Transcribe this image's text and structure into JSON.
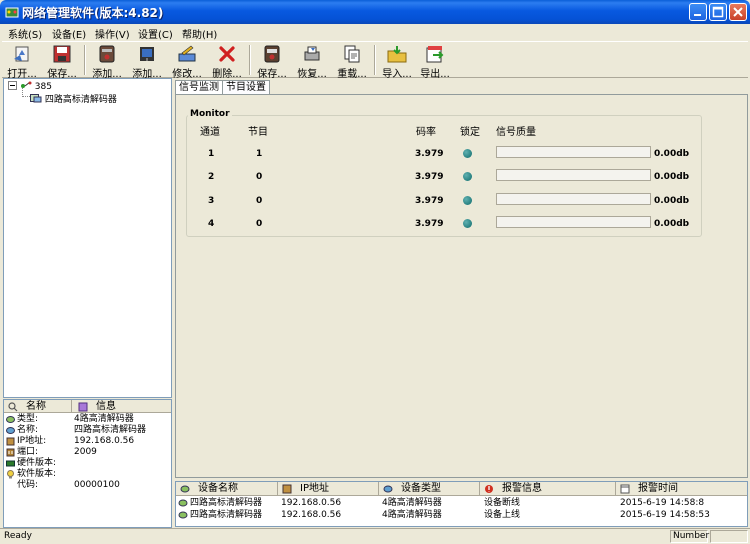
{
  "window": {
    "title": "网络管理软件(版本:4.82)"
  },
  "menu": [
    {
      "label": "系统(S)"
    },
    {
      "label": "设备(E)"
    },
    {
      "label": "操作(V)"
    },
    {
      "label": "设置(C)"
    },
    {
      "label": "帮助(H)"
    }
  ],
  "toolbar": [
    {
      "label": "打开...",
      "icon": "open-icon"
    },
    {
      "label": "保存...",
      "icon": "save-disk-icon"
    },
    {
      "label": "添加...",
      "icon": "add-device-icon"
    },
    {
      "label": "添加...",
      "icon": "add-device-2-icon"
    },
    {
      "label": "修改...",
      "icon": "edit-icon"
    },
    {
      "label": "删除...",
      "icon": "delete-x-icon"
    },
    {
      "label": "保存...",
      "icon": "save-device-icon"
    },
    {
      "label": "恢复...",
      "icon": "restore-icon"
    },
    {
      "label": "重载...",
      "icon": "reload-icon"
    },
    {
      "label": "导入...",
      "icon": "import-icon"
    },
    {
      "label": "导出...",
      "icon": "export-icon"
    }
  ],
  "tree": {
    "root": "385",
    "child": "四路高标清解码器"
  },
  "properties": {
    "col_name": "名称",
    "col_info": "信息",
    "rows": [
      {
        "key": "类型:",
        "value": "4路高清解码器"
      },
      {
        "key": "名称:",
        "value": "四路高标清解码器"
      },
      {
        "key": "IP地址:",
        "value": "192.168.0.56"
      },
      {
        "key": "端口:",
        "value": "2009"
      },
      {
        "key": "硬件版本:",
        "value": ""
      },
      {
        "key": "软件版本:",
        "value": ""
      },
      {
        "key": "代码:",
        "value": "00000100"
      }
    ]
  },
  "tabs": [
    {
      "label": "信号监测"
    },
    {
      "label": "节目设置"
    }
  ],
  "monitor": {
    "group_title": "Monitor",
    "headers": {
      "channel": "通道",
      "program": "节目",
      "bitrate": "码率",
      "lock": "锁定",
      "quality": "信号质量"
    },
    "rows": [
      {
        "channel": "1",
        "program": "1",
        "bitrate": "3.979",
        "quality": "0.00db",
        "quality_level": 0
      },
      {
        "channel": "2",
        "program": "0",
        "bitrate": "3.979",
        "quality": "0.00db",
        "quality_level": 0
      },
      {
        "channel": "3",
        "program": "0",
        "bitrate": "3.979",
        "quality": "0.00db",
        "quality_level": 0
      },
      {
        "channel": "4",
        "program": "0",
        "bitrate": "3.979",
        "quality": "0.00db",
        "quality_level": 0
      }
    ],
    "lock_color": "#0E6B6B"
  },
  "alarms": {
    "columns": [
      "设备名称",
      "IP地址",
      "设备类型",
      "报警信息",
      "报警时间"
    ],
    "rows": [
      {
        "name": "四路高标清解码器",
        "ip": "192.168.0.56",
        "type": "4路高清解码器",
        "info": "设备断线",
        "time": "2015-6-19 14:58:8"
      },
      {
        "name": "四路高标清解码器",
        "ip": "192.168.0.56",
        "type": "4路高清解码器",
        "info": "设备上线",
        "time": "2015-6-19 14:58:53"
      }
    ]
  },
  "status": {
    "text": "Ready",
    "pane": "Number"
  }
}
